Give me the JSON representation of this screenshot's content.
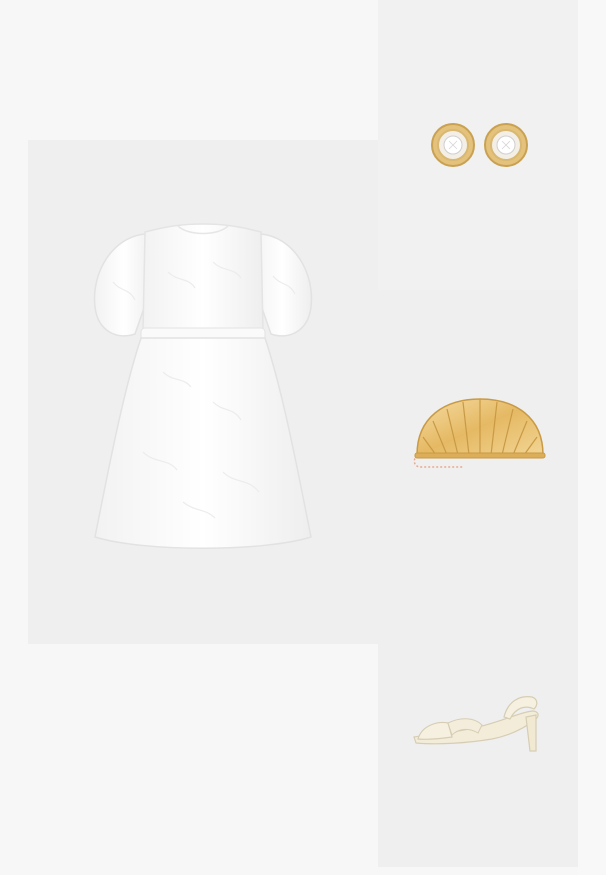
{
  "outfit": {
    "items": [
      {
        "id": "dress",
        "icon": "white-puff-sleeve-dress-image"
      },
      {
        "id": "earrings",
        "icon": "gold-crystal-stud-earrings-image"
      },
      {
        "id": "clutch",
        "icon": "gold-shell-clutch-image"
      },
      {
        "id": "sandal",
        "icon": "cream-slingback-sandal-image"
      }
    ]
  },
  "colors": {
    "page_background": "#f7f7f7",
    "tile_background": "#efefef",
    "gold": "#e8c27a",
    "cream": "#f3ecd9"
  }
}
